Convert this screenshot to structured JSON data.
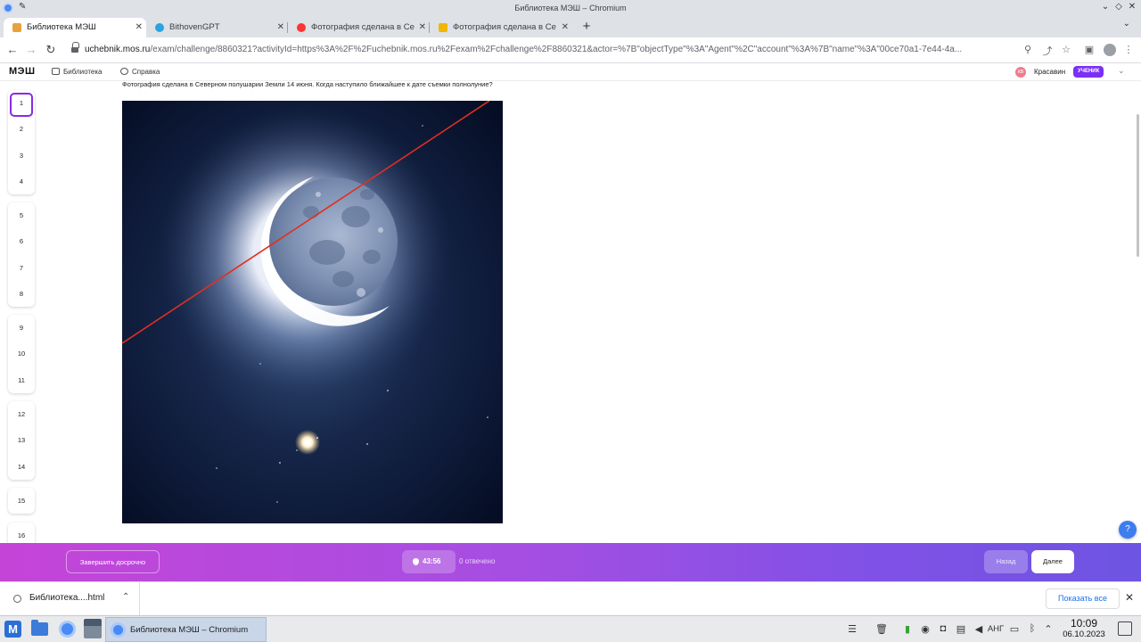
{
  "window": {
    "title": "Библиотека МЭШ – Chromium"
  },
  "tabs": [
    {
      "label": "Библиотека МЭШ",
      "active": true,
      "icon": "book-favicon-icon",
      "color": "#e8a23a"
    },
    {
      "label": "BithovenGPT",
      "active": false,
      "icon": "telegram-favicon-icon",
      "color": "#2aa3df"
    },
    {
      "label": "Фотография сделана в Се",
      "active": false,
      "icon": "yandex-favicon-icon",
      "color": "#f33"
    },
    {
      "label": "Фотография сделана в Се",
      "active": false,
      "icon": "folder-favicon-icon",
      "color": "#f2b705"
    }
  ],
  "address_bar": {
    "host": "uchebnik.mos.ru",
    "path": "/exam/challenge/8860321?activityId=https%3A%2F%2Fuchebnik.mos.ru%2Fexam%2Fchallenge%2F8860321&actor=%7B\"objectType\"%3A\"Agent\"%2C\"account\"%3A%7B\"name\"%3A\"00ce70a1-7e44-4a..."
  },
  "site": {
    "logo": "МЭШ",
    "nav_library": "Библиотека",
    "nav_help": "Справка",
    "user_initials": "КВ",
    "user_name": "Красавин",
    "role_badge": "УЧЕНИК"
  },
  "question_nav": {
    "current": 1,
    "groups": [
      [
        "1",
        "2",
        "3",
        "4"
      ],
      [
        "5",
        "6",
        "7",
        "8"
      ],
      [
        "9",
        "10",
        "11"
      ],
      [
        "12",
        "13",
        "14"
      ],
      [
        "15"
      ],
      [
        "16"
      ]
    ]
  },
  "question": {
    "text": "Фотография сделана в Северном полушарии Земли 14 июня. Когда наступило ближайшее к дате съемки полнолуние?"
  },
  "action_bar": {
    "finish_label": "Завершить досрочно",
    "timer": "43:56",
    "answered": "0 отвечено",
    "back_label": "Назад",
    "next_label": "Далее"
  },
  "help_button": "?",
  "download_shelf": {
    "file_name": "Библиотека....html",
    "show_all": "Показать все"
  },
  "taskbar": {
    "task_label": "Библиотека МЭШ – Chromium",
    "lang": "АНГ",
    "time": "10:09",
    "date": "06.10.2023"
  },
  "colors": {
    "accent_purple": "#8a2be2",
    "bar_gradient_start": "#c544d8",
    "bar_gradient_end": "#6d54e2",
    "annotation_line": "#e0301e"
  }
}
